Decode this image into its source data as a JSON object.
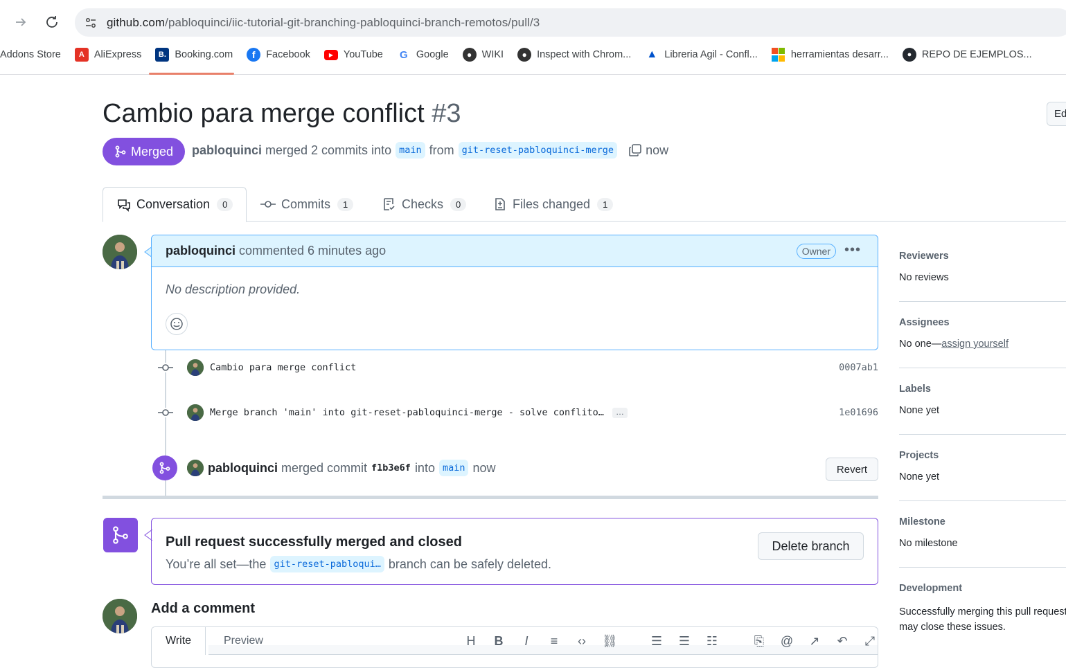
{
  "browser": {
    "url_host": "github.com",
    "url_path": "/pabloquinci/iic-tutorial-git-branching-pabloquinci-branch-remotos/pull/3",
    "bookmarks": [
      {
        "label": "Addons Store",
        "icon": "none",
        "color": ""
      },
      {
        "label": "AliExpress",
        "icon": "aliexpress-icon",
        "color": "#e43225"
      },
      {
        "label": "Booking.com",
        "icon": "booking-icon",
        "color": "#003580"
      },
      {
        "label": "Facebook",
        "icon": "facebook-icon",
        "color": "#1877f2"
      },
      {
        "label": "YouTube",
        "icon": "youtube-icon",
        "color": "#ff0000"
      },
      {
        "label": "Google",
        "icon": "google-icon",
        "color": "#4285f4"
      },
      {
        "label": "WIKI",
        "icon": "globe-icon",
        "color": "#333333"
      },
      {
        "label": "Inspect with Chrom...",
        "icon": "globe-icon",
        "color": "#333333"
      },
      {
        "label": "Libreria Agil - Confl...",
        "icon": "atlassian-icon",
        "color": "#0052cc"
      },
      {
        "label": "herramientas desarr...",
        "icon": "microsoft-icon",
        "color": "#f25022"
      },
      {
        "label": "REPO DE EJEMPLOS...",
        "icon": "github-icon",
        "color": "#24292f"
      }
    ]
  },
  "pr": {
    "title": "Cambio para merge conflict",
    "number": "#3",
    "edit_label": "Ed",
    "state": "Merged",
    "author": "pabloquinci",
    "merged_text": "merged 2 commits into",
    "base_branch": "main",
    "from_text": "from",
    "head_branch": "git-reset-pabloquinci-merge",
    "time": "now"
  },
  "tabs": [
    {
      "label": "Conversation",
      "count": "0"
    },
    {
      "label": "Commits",
      "count": "1"
    },
    {
      "label": "Checks",
      "count": "0"
    },
    {
      "label": "Files changed",
      "count": "1"
    }
  ],
  "comment": {
    "author": "pabloquinci",
    "action": "commented 6 minutes ago",
    "badge": "Owner",
    "body": "No description provided."
  },
  "commits": [
    {
      "message": "Cambio para merge conflict",
      "sha": "0007ab1"
    },
    {
      "message": "Merge branch 'main' into git-reset-pabloquinci-merge - solve conflito…",
      "sha": "1e01696",
      "more": "…"
    }
  ],
  "merge_event": {
    "author": "pabloquinci",
    "text": "merged commit",
    "sha": "f1b3e6f",
    "into": "into",
    "branch": "main",
    "time": "now",
    "revert_label": "Revert"
  },
  "merged_box": {
    "heading": "Pull request successfully merged and closed",
    "text_before": "You’re all set—the",
    "branch": "git-reset-pabloqui…",
    "text_after": "branch can be safely deleted.",
    "delete_label": "Delete branch"
  },
  "add_comment": {
    "heading": "Add a comment",
    "write_tab": "Write",
    "preview_tab": "Preview"
  },
  "sidebar": {
    "reviewers": {
      "heading": "Reviewers",
      "value": "No reviews"
    },
    "assignees": {
      "heading": "Assignees",
      "value": "No one—",
      "link": "assign yourself"
    },
    "labels": {
      "heading": "Labels",
      "value": "None yet"
    },
    "projects": {
      "heading": "Projects",
      "value": "None yet"
    },
    "milestone": {
      "heading": "Milestone",
      "value": "No milestone"
    },
    "development": {
      "heading": "Development",
      "value": "Successfully merging this pull request may close these issues."
    }
  },
  "colors": {
    "accent_purple": "#8250df",
    "link_blue": "#0969da",
    "comment_header": "#ddf4ff"
  }
}
